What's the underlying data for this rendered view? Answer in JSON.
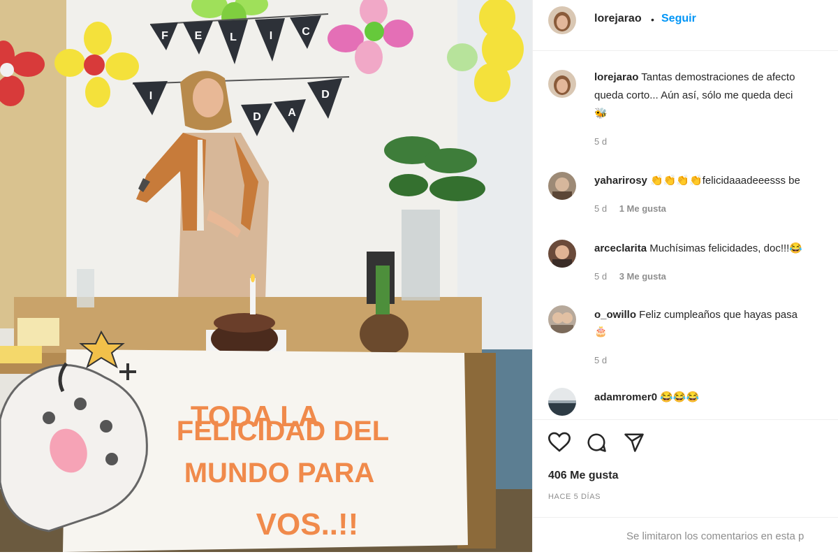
{
  "post": {
    "author": "lorejarao",
    "follow_label": "Seguir",
    "separator": "•",
    "caption_text_line1": "Tantas demostraciones de afecto",
    "caption_text_line2": "queda corto... Aún así, sólo me queda deci",
    "caption_emoji": "🐝",
    "caption_time": "5 d",
    "banner_text": "TODA LA FELICIDAD DEL MUNDO PARA VOS..!!",
    "bunting_letters": [
      "F",
      "E",
      "L",
      "I",
      "C",
      "I",
      "D",
      "A",
      "D"
    ]
  },
  "comments": [
    {
      "user": "yaharirosy",
      "text": "👏👏👏👏felicidaaadeeesss be",
      "time": "5 d",
      "likes": "1 Me gusta"
    },
    {
      "user": "arceclarita",
      "text": "Muchísimas felicidades, doc!!!😂",
      "time": "5 d",
      "likes": "3 Me gusta"
    },
    {
      "user": "o_owillo",
      "text": "Feliz cumpleaños que hayas pasa",
      "text2": "🎂",
      "time": "5 d",
      "likes": ""
    },
    {
      "user": "adamromer0",
      "text": "😂😂😂",
      "time": "",
      "likes": ""
    }
  ],
  "likes_count": "406 Me gusta",
  "posted_ago": "HACE 5 DÍAS",
  "comments_limited": "Se limitaron los comentarios en esta p",
  "icons": {
    "like": "heart-icon",
    "comment": "comment-icon",
    "share": "share-icon"
  },
  "colors": {
    "follow": "#0095f6",
    "muted": "#8e8e8e",
    "banner_text": "#f08a4b"
  }
}
